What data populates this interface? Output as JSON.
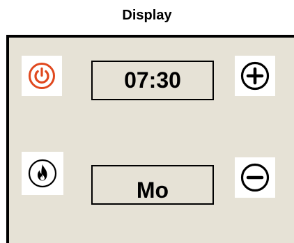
{
  "header": {
    "title": "Display"
  },
  "display": {
    "time_value": "07:30",
    "day_value": "Mo"
  },
  "icons": {
    "power": "power-icon",
    "plus": "plus-icon",
    "flame": "flame-icon",
    "minus": "minus-icon"
  },
  "colors": {
    "panel_background": "#e6e2d6",
    "power_accent": "#e0481e",
    "border": "#000000"
  }
}
